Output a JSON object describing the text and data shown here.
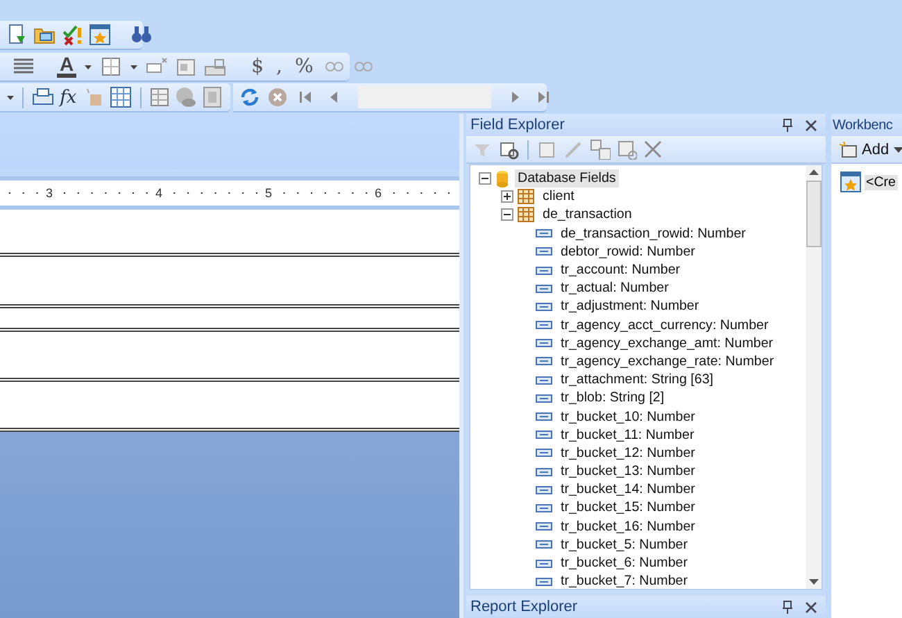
{
  "toolbar": {
    "font_color_glyph": "A",
    "function_glyph": "fx",
    "format_glyphs": [
      "$",
      ",",
      "%"
    ]
  },
  "ruler": {
    "marks": [
      "3",
      "4",
      "5",
      "6"
    ]
  },
  "field_explorer": {
    "title": "Field Explorer",
    "tree": [
      {
        "label": "Database Fields",
        "kind": "database",
        "expanded": true,
        "selected": true,
        "children": [
          {
            "label": "client",
            "kind": "table",
            "expanded": false,
            "selected": false
          },
          {
            "label": "de_transaction",
            "kind": "table",
            "expanded": true,
            "selected": false,
            "children": [
              {
                "label": "de_transaction_rowid: Number",
                "kind": "field",
                "selected": false
              },
              {
                "label": "debtor_rowid: Number",
                "kind": "field",
                "selected": false
              },
              {
                "label": "tr_account: Number",
                "kind": "field",
                "selected": false
              },
              {
                "label": "tr_actual: Number",
                "kind": "field",
                "selected": false
              },
              {
                "label": "tr_adjustment: Number",
                "kind": "field",
                "selected": false
              },
              {
                "label": "tr_agency_acct_currency: Number",
                "kind": "field",
                "selected": false
              },
              {
                "label": "tr_agency_exchange_amt: Number",
                "kind": "field",
                "selected": false
              },
              {
                "label": "tr_agency_exchange_rate: Number",
                "kind": "field",
                "selected": false
              },
              {
                "label": "tr_attachment: String [63]",
                "kind": "field",
                "selected": false
              },
              {
                "label": "tr_blob: String [2]",
                "kind": "field",
                "selected": false
              },
              {
                "label": "tr_bucket_10: Number",
                "kind": "field",
                "selected": false
              },
              {
                "label": "tr_bucket_11: Number",
                "kind": "field",
                "selected": false
              },
              {
                "label": "tr_bucket_12: Number",
                "kind": "field",
                "selected": false
              },
              {
                "label": "tr_bucket_13: Number",
                "kind": "field",
                "selected": false
              },
              {
                "label": "tr_bucket_14: Number",
                "kind": "field",
                "selected": false
              },
              {
                "label": "tr_bucket_15: Number",
                "kind": "field",
                "selected": false
              },
              {
                "label": "tr_bucket_16: Number",
                "kind": "field",
                "selected": false
              },
              {
                "label": "tr_bucket_5: Number",
                "kind": "field",
                "selected": false
              },
              {
                "label": "tr_bucket_6: Number",
                "kind": "field",
                "selected": false
              },
              {
                "label": "tr_bucket_7: Number",
                "kind": "field",
                "selected": false
              }
            ]
          }
        ]
      }
    ]
  },
  "report_explorer": {
    "title": "Report Explorer"
  },
  "workbench": {
    "title": "Workbenc",
    "add_button": "Add",
    "items": [
      {
        "label": "<Cre"
      }
    ]
  }
}
